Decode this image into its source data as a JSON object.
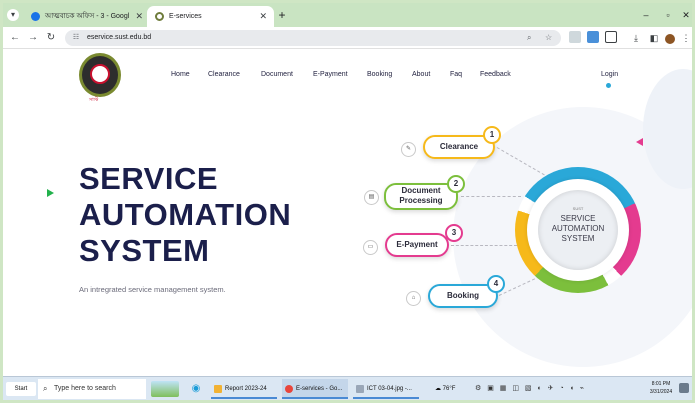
{
  "browser": {
    "tabs": [
      {
        "label": "আত্মবাচক অফিস - 3 - Googl",
        "active": false
      },
      {
        "label": "E-services",
        "active": true
      }
    ],
    "url": "eservice.sust.edu.bd"
  },
  "site": {
    "logo_caption": "সাস্ট",
    "nav": [
      "Home",
      "Clearance",
      "Document",
      "E-Payment",
      "Booking",
      "About",
      "Faq",
      "Feedback"
    ],
    "login": "Login"
  },
  "hero": {
    "title_lines": [
      "SERVICE",
      "AUTOMATION",
      "SYSTEM"
    ],
    "subtitle": "An intregrated service management system."
  },
  "diagram": {
    "hub_small": "SUST",
    "hub_lines": [
      "SERVICE",
      "AUTOMATION",
      "SYSTEM"
    ],
    "services": [
      {
        "num": "1",
        "label": "Clearance",
        "color": "#f6b91a"
      },
      {
        "num": "2",
        "label_lines": [
          "Document",
          "Processing"
        ],
        "color": "#7cbf3c"
      },
      {
        "num": "3",
        "label": "E-Payment",
        "color": "#e43b8f"
      },
      {
        "num": "4",
        "label": "Booking",
        "color": "#2aa8d8"
      }
    ]
  },
  "taskbar": {
    "start": "Start",
    "search_placeholder": "Type here to search",
    "tasks": [
      "Report 2023-24",
      "E-services - Go...",
      "ICT 03-04.jpg -..."
    ],
    "weather": "76°F",
    "time": "8:01 PM",
    "date": "3/31/2024"
  },
  "colors": {
    "accent_green": "#22b14c",
    "accent_pink": "#e43b8f",
    "title_navy": "#1b1f4b"
  }
}
